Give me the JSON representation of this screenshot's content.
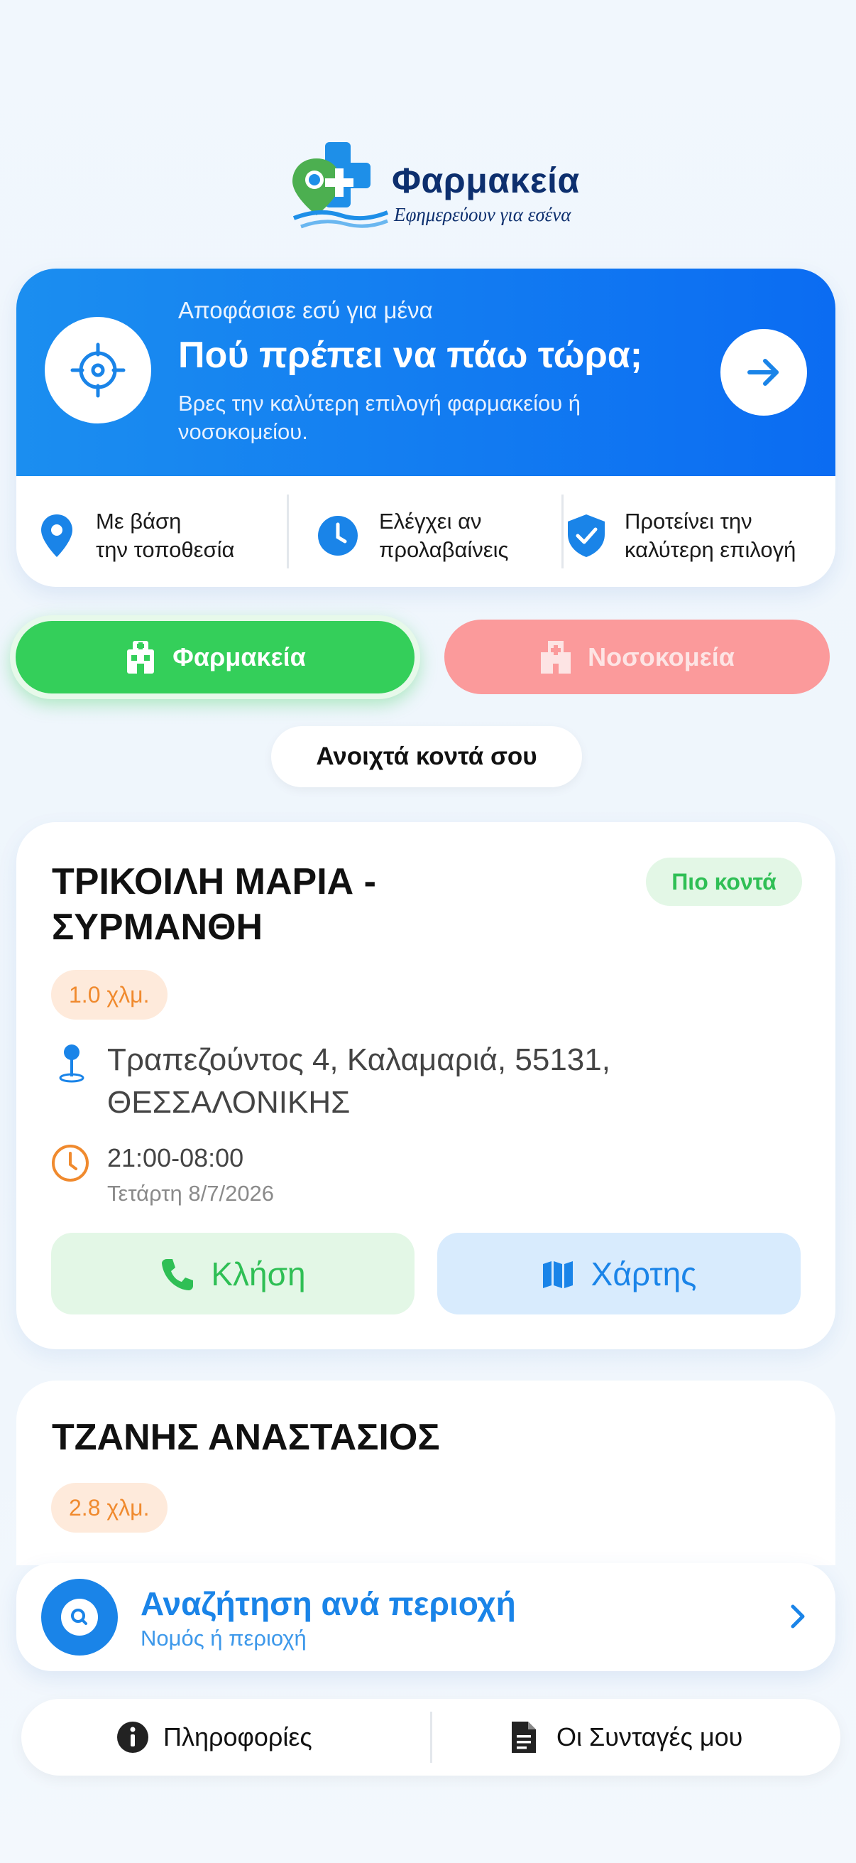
{
  "logo": {
    "title": "Φαρμακεία",
    "subtitle": "Εφημερεύουν για εσένα"
  },
  "hero": {
    "kicker": "Αποφάσισε εσύ για μένα",
    "title": "Πού πρέπει να πάω τώρα;",
    "description": "Βρες την καλύτερη επιλογή φαρμακείου ή νοσοκομείου.",
    "features": [
      {
        "icon": "location-pin-icon",
        "line1": "Με βάση",
        "line2": "την τοποθεσία"
      },
      {
        "icon": "clock-icon",
        "line1": "Ελέγχει αν",
        "line2": "προλαβαίνεις"
      },
      {
        "icon": "shield-check-icon",
        "line1": "Προτείνει την",
        "line2": "καλύτερη επιλογή"
      }
    ]
  },
  "toggle": {
    "pharmacies": "Φαρμακεία",
    "hospitals": "Νοσοκομεία"
  },
  "open_near_label": "Ανοιχτά κοντά σου",
  "cards": [
    {
      "name": "ΤΡΙΚΟΙΛΗ ΜΑΡΙΑ - ΣΥΡΜΑΝΘΗ",
      "badge": "Πιο κοντά",
      "distance": "1.0 χλμ.",
      "address": "Τραπεζούντος 4, Καλαμαριά, 55131, ΘΕΣΣΑΛΟΝΙΚΗΣ",
      "hours": "21:00-08:00",
      "date": "Τετάρτη 8/7/2026",
      "call_label": "Κλήση",
      "map_label": "Χάρτης"
    },
    {
      "name": "ΤΖΑΝΗΣ ΑΝΑΣΤΑΣΙΟΣ",
      "distance": "2.8 χλμ."
    }
  ],
  "search": {
    "title": "Αναζήτηση ανά περιοχή",
    "subtitle": "Νομός ή περιοχή"
  },
  "bottom_nav": {
    "info": "Πληροφορίες",
    "prescriptions": "Οι Συνταγές μου"
  },
  "colors": {
    "brand_blue": "#1a84e8",
    "green": "#34cf5a",
    "hospital_pink": "#fb9a9b",
    "distance_orange": "#f08a2e",
    "navy": "#0d2f6e"
  }
}
